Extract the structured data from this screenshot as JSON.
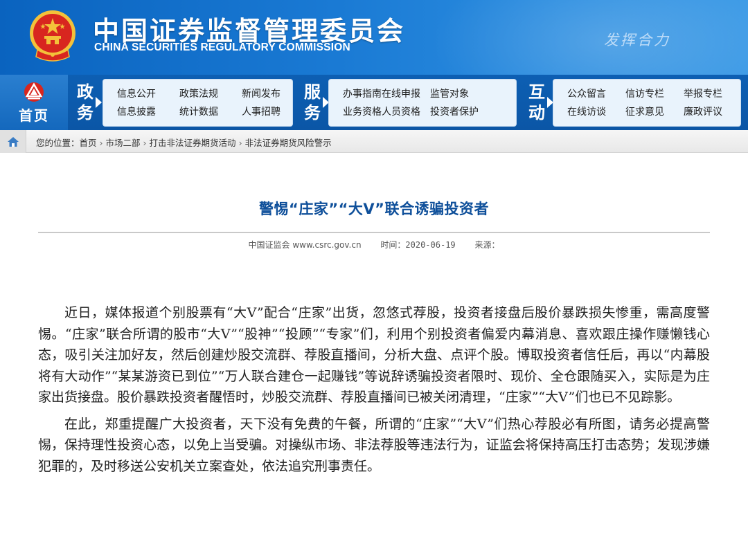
{
  "header": {
    "title_cn": "中国证券监督管理委员会",
    "title_en": "CHINA SECURITIES REGULATORY COMMISSION",
    "slogan": "发挥合力",
    "emblem_icon": "national-emblem-icon"
  },
  "nav": {
    "home_label": "首页",
    "sections": [
      {
        "label_1": "政",
        "label_2": "务",
        "items": [
          "信息公开",
          "政策法规",
          "新闻发布",
          "信息披露",
          "统计数据",
          "人事招聘"
        ]
      },
      {
        "label_1": "服",
        "label_2": "务",
        "items": [
          "办事指南",
          "在线申报",
          "监管对象",
          "业务资格",
          "人员资格",
          "投资者保护"
        ]
      },
      {
        "label_1": "互",
        "label_2": "动",
        "items": [
          "公众留言",
          "信访专栏",
          "举报专栏",
          "在线访谈",
          "征求意见",
          "廉政评议"
        ]
      }
    ]
  },
  "breadcrumb": {
    "prefix": "您的位置：",
    "items": [
      "首页",
      "市场二部",
      "打击非法证券期货活动",
      "非法证券期货风险警示"
    ],
    "separator": "›"
  },
  "article": {
    "title": "警惕“庄家”“大V”联合诱骗投资者",
    "source": "中国证监会 www.csrc.gov.cn",
    "time": "时间：2020-06-19",
    "origin": "来源：",
    "paragraphs": [
      "近日，媒体报道个别股票有“大V”配合“庄家”出货，忽悠式荐股，投资者接盘后股价暴跌损失惨重，需高度警惕。“庄家”联合所谓的股市“大V”“股神”“投顾”“专家”们，利用个别投资者偏爱内幕消息、喜欢跟庄操作赚懒钱心态，吸引关注加好友，然后创建炒股交流群、荐股直播间，分析大盘、点评个股。博取投资者信任后，再以“内幕股将有大动作”“某某游资已到位”“万人联合建仓一起赚钱”等说辞诱骗投资者限时、现价、全仓跟随买入，实际是为庄家出货接盘。股价暴跌投资者醒悟时，炒股交流群、荐股直播间已被关闭清理，“庄家”“大V”们也已不见踪影。",
      "在此，郑重提醒广大投资者，天下没有免费的午餐，所谓的“庄家”“大V”们热心荐股必有所图，请务必提高警惕，保持理性投资心态，以免上当受骗。对操纵市场、非法荐股等违法行为，证监会将保持高压打击态势；发现涉嫌犯罪的，及时移送公安机关立案查处，依法追究刑事责任。"
    ]
  },
  "colors": {
    "header_blue": "#1a7ad4",
    "nav_blue": "#0b56a6",
    "title_blue": "#0e4f9a",
    "emblem_red": "#d8261f",
    "emblem_gold": "#f3c13a"
  }
}
